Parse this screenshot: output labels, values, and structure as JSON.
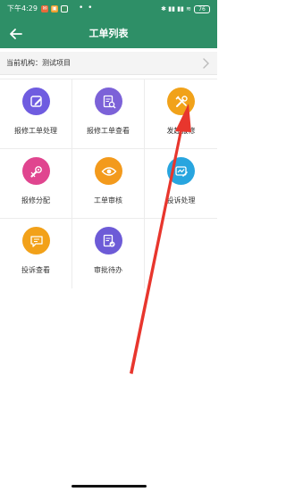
{
  "status_bar": {
    "time": "下午4:29",
    "badge_a": "✉",
    "badge_b": "▣",
    "dots": "• •",
    "icons": "✱ ▮▮ ▮▮ ≋",
    "battery": "76"
  },
  "app_bar": {
    "back_icon": "arrow-left-icon",
    "title": "工单列表"
  },
  "org_bar": {
    "label": "当前机构：",
    "value": "测试项目"
  },
  "menu": {
    "items": [
      {
        "label": "报修工单处理",
        "icon": "edit-square-icon",
        "color": "#6f5ce0"
      },
      {
        "label": "报修工单查看",
        "icon": "document-search-icon",
        "color": "#7c62d8"
      },
      {
        "label": "发起报修",
        "icon": "tools-icon",
        "color": "#f1a21a"
      },
      {
        "label": "报修分配",
        "icon": "wrench-gear-icon",
        "color": "#e0458f"
      },
      {
        "label": "工单审核",
        "icon": "eye-icon",
        "color": "#f39a1c"
      },
      {
        "label": "投诉处理",
        "icon": "complaint-edit-icon",
        "color": "#28a5df"
      },
      {
        "label": "投诉查看",
        "icon": "chat-bubble-icon",
        "color": "#f2a119"
      },
      {
        "label": "审批待办",
        "icon": "approval-doc-icon",
        "color": "#6d5bd7"
      }
    ]
  },
  "colors": {
    "primary": "#2e8f67",
    "annotation_arrow": "#e8362d"
  }
}
